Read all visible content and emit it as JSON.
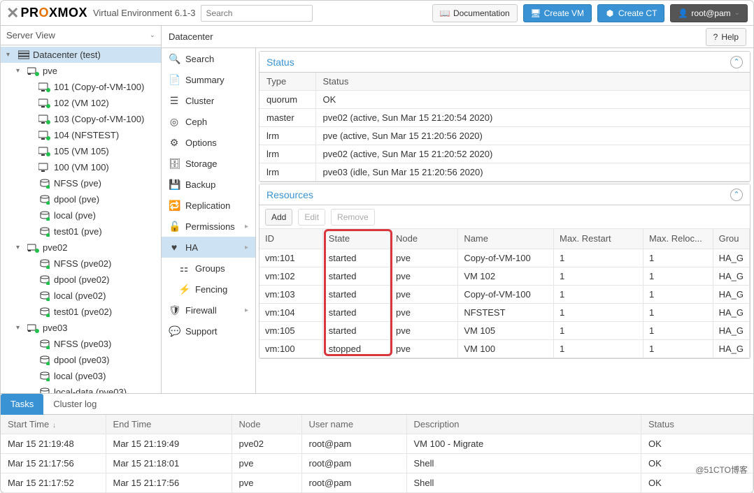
{
  "header": {
    "brand_pre": "PR",
    "brand_o": "O",
    "brand_post": "XMOX",
    "env": "Virtual Environment 6.1-3",
    "search_placeholder": "Search",
    "doc": "Documentation",
    "create_vm": "Create VM",
    "create_ct": "Create CT",
    "user": "root@pam"
  },
  "sidebar": {
    "view_mode": "Server View",
    "items": [
      {
        "depth": 0,
        "icon": "datacenter",
        "label": "Datacenter (test)",
        "selected": true,
        "exp": "open"
      },
      {
        "depth": 1,
        "icon": "node-on",
        "label": "pve",
        "exp": "open"
      },
      {
        "depth": 2,
        "icon": "vm-on",
        "label": "101 (Copy-of-VM-100)"
      },
      {
        "depth": 2,
        "icon": "vm-on",
        "label": "102 (VM 102)"
      },
      {
        "depth": 2,
        "icon": "vm-on",
        "label": "103 (Copy-of-VM-100)"
      },
      {
        "depth": 2,
        "icon": "vm-on",
        "label": "104 (NFSTEST)"
      },
      {
        "depth": 2,
        "icon": "vm-on",
        "label": "105 (VM 105)"
      },
      {
        "depth": 2,
        "icon": "vm-off",
        "label": "100 (VM 100)"
      },
      {
        "depth": 2,
        "icon": "storage",
        "label": "NFSS (pve)"
      },
      {
        "depth": 2,
        "icon": "storage",
        "label": "dpool (pve)"
      },
      {
        "depth": 2,
        "icon": "storage",
        "label": "local (pve)"
      },
      {
        "depth": 2,
        "icon": "storage",
        "label": "test01 (pve)"
      },
      {
        "depth": 1,
        "icon": "node-on",
        "label": "pve02",
        "exp": "open"
      },
      {
        "depth": 2,
        "icon": "storage",
        "label": "NFSS (pve02)"
      },
      {
        "depth": 2,
        "icon": "storage",
        "label": "dpool (pve02)"
      },
      {
        "depth": 2,
        "icon": "storage",
        "label": "local (pve02)"
      },
      {
        "depth": 2,
        "icon": "storage",
        "label": "test01 (pve02)"
      },
      {
        "depth": 1,
        "icon": "node-on",
        "label": "pve03",
        "exp": "open"
      },
      {
        "depth": 2,
        "icon": "storage",
        "label": "NFSS (pve03)"
      },
      {
        "depth": 2,
        "icon": "storage",
        "label": "dpool (pve03)"
      },
      {
        "depth": 2,
        "icon": "storage",
        "label": "local (pve03)"
      },
      {
        "depth": 2,
        "icon": "storage",
        "label": "local-data (pve03)"
      }
    ]
  },
  "content": {
    "breadcrumb": "Datacenter",
    "help": "Help"
  },
  "submenu": [
    {
      "icon": "search",
      "label": "Search"
    },
    {
      "icon": "summary",
      "label": "Summary"
    },
    {
      "icon": "cluster",
      "label": "Cluster"
    },
    {
      "icon": "ceph",
      "label": "Ceph"
    },
    {
      "icon": "options",
      "label": "Options"
    },
    {
      "icon": "storage",
      "label": "Storage"
    },
    {
      "icon": "backup",
      "label": "Backup"
    },
    {
      "icon": "replication",
      "label": "Replication"
    },
    {
      "icon": "permissions",
      "label": "Permissions",
      "arrow": true
    },
    {
      "icon": "ha",
      "label": "HA",
      "selected": true,
      "arrow": true
    },
    {
      "icon": "groups",
      "label": "Groups",
      "sub": true
    },
    {
      "icon": "fencing",
      "label": "Fencing",
      "sub": true
    },
    {
      "icon": "firewall",
      "label": "Firewall",
      "arrow": true
    },
    {
      "icon": "support",
      "label": "Support"
    }
  ],
  "status_panel": {
    "title": "Status",
    "headers": [
      "Type",
      "Status"
    ],
    "rows": [
      {
        "type": "quorum",
        "status": "OK"
      },
      {
        "type": "master",
        "status": "pve02 (active, Sun Mar 15 21:20:54 2020)"
      },
      {
        "type": "lrm",
        "status": "pve (active, Sun Mar 15 21:20:56 2020)"
      },
      {
        "type": "lrm",
        "status": "pve02 (active, Sun Mar 15 21:20:52 2020)"
      },
      {
        "type": "lrm",
        "status": "pve03 (idle, Sun Mar 15 21:20:56 2020)"
      }
    ]
  },
  "resources_panel": {
    "title": "Resources",
    "add": "Add",
    "edit": "Edit",
    "remove": "Remove",
    "headers": [
      "ID",
      "State",
      "Node",
      "Name",
      "Max. Restart",
      "Max. Reloc...",
      "Grou"
    ],
    "rows": [
      {
        "id": "vm:101",
        "state": "started",
        "node": "pve",
        "name": "Copy-of-VM-100",
        "mr": "1",
        "ml": "1",
        "g": "HA_G"
      },
      {
        "id": "vm:102",
        "state": "started",
        "node": "pve",
        "name": "VM 102",
        "mr": "1",
        "ml": "1",
        "g": "HA_G"
      },
      {
        "id": "vm:103",
        "state": "started",
        "node": "pve",
        "name": "Copy-of-VM-100",
        "mr": "1",
        "ml": "1",
        "g": "HA_G"
      },
      {
        "id": "vm:104",
        "state": "started",
        "node": "pve",
        "name": "NFSTEST",
        "mr": "1",
        "ml": "1",
        "g": "HA_G"
      },
      {
        "id": "vm:105",
        "state": "started",
        "node": "pve",
        "name": "VM 105",
        "mr": "1",
        "ml": "1",
        "g": "HA_G"
      },
      {
        "id": "vm:100",
        "state": "stopped",
        "node": "pve",
        "name": "VM 100",
        "mr": "1",
        "ml": "1",
        "g": "HA_G"
      }
    ]
  },
  "tasks": {
    "tab_tasks": "Tasks",
    "tab_cluster": "Cluster log",
    "headers": [
      "Start Time",
      "End Time",
      "Node",
      "User name",
      "Description",
      "Status"
    ],
    "rows": [
      {
        "st": "Mar 15 21:19:48",
        "et": "Mar 15 21:19:49",
        "node": "pve02",
        "user": "root@pam",
        "desc": "VM 100 - Migrate",
        "status": "OK"
      },
      {
        "st": "Mar 15 21:17:56",
        "et": "Mar 15 21:18:01",
        "node": "pve",
        "user": "root@pam",
        "desc": "Shell",
        "status": "OK"
      },
      {
        "st": "Mar 15 21:17:52",
        "et": "Mar 15 21:17:56",
        "node": "pve",
        "user": "root@pam",
        "desc": "Shell",
        "status": "OK"
      }
    ]
  },
  "watermark": "@51CTO博客"
}
